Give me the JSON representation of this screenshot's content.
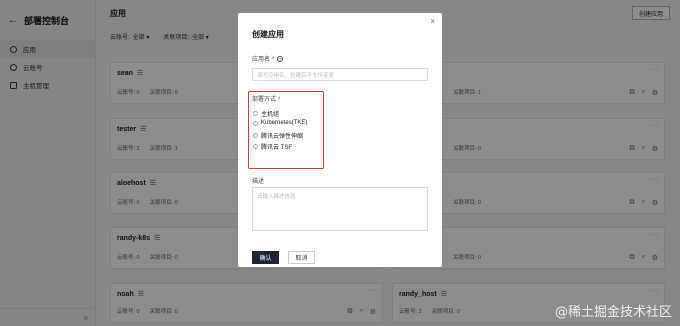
{
  "sidebar": {
    "back": "←",
    "title": "部署控制台",
    "items": [
      {
        "label": "应用"
      },
      {
        "label": "云账号"
      },
      {
        "label": "主机管理"
      }
    ],
    "collapse": "«"
  },
  "main": {
    "title": "应用",
    "create_button": "创建应用",
    "filters": [
      {
        "label": "云账号:",
        "value": "全部"
      },
      {
        "label": "关联项目:",
        "value": "全部"
      }
    ]
  },
  "cards": [
    {
      "name": "sean",
      "acc": "云账号: 0",
      "proj": "关联项目: 0"
    },
    {
      "name": "",
      "acc": "",
      "proj": "关联项目: 1"
    },
    {
      "name": "tester",
      "acc": "云账号: 2",
      "proj": "关联项目: 1"
    },
    {
      "name": "",
      "acc": "",
      "proj": "关联项目: 0"
    },
    {
      "name": "aloehost",
      "acc": "云账号: 0",
      "proj": "关联项目: 0"
    },
    {
      "name": "",
      "acc": "",
      "proj": "关联项目: 0"
    },
    {
      "name": "randy-k8s",
      "acc": "云账号: 0",
      "proj": "关联项目: 0"
    },
    {
      "name": "",
      "acc": "",
      "proj": "关联项目: 0"
    },
    {
      "name": "noah",
      "acc": "云账号: 0",
      "proj": "关联项目: 0"
    },
    {
      "name": "randy_host",
      "acc": "云账号: 2",
      "proj": "关联项目: 0"
    }
  ],
  "modal": {
    "title": "创建应用",
    "close": "×",
    "name_label": "应用名",
    "name_placeholder": "填写应用名，创建后不支持变更",
    "deploy_label": "部署方式",
    "deploy_options": [
      "主机组",
      "Kubernetes(TKE)",
      "腾讯云弹性伸缩",
      "腾讯云 TSF"
    ],
    "desc_label": "描述",
    "desc_placeholder": "请输入描述信息",
    "confirm": "确认",
    "cancel": "取消"
  },
  "watermark": "@稀土掘金技术社区"
}
